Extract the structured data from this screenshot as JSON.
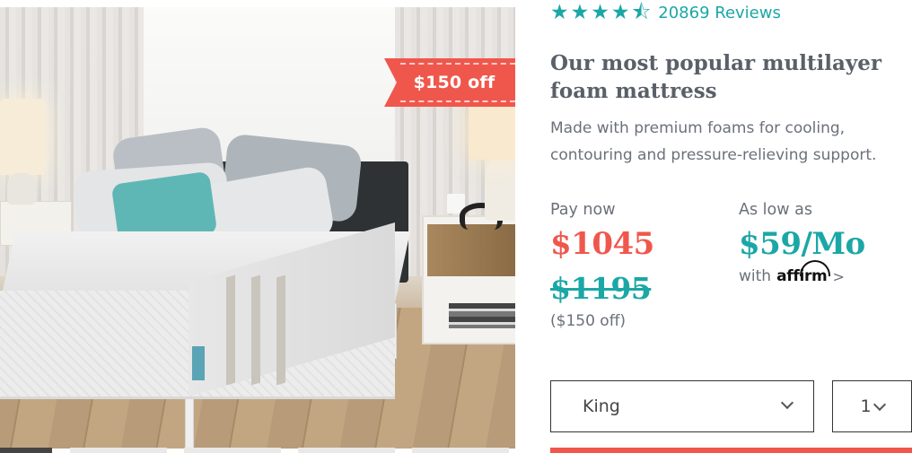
{
  "product_image": {
    "discount_ribbon": "$150 off"
  },
  "rating": {
    "stars": "★★★★⯪",
    "review_count_label": "20869 Reviews"
  },
  "product": {
    "title": "Our most popular multilayer foam mattress",
    "description": "Made with premium foams for cooling, contouring and pressure-relieving support."
  },
  "pricing": {
    "pay_now_label": "Pay now",
    "current_price": "$1045",
    "original_price": "$1195",
    "savings": "($150 off)",
    "financing_label": "As low as",
    "monthly_price": "$59/Mo",
    "with_label": "with",
    "provider": "affirm",
    "provider_arrow": ">"
  },
  "options": {
    "size_selected": "King",
    "quantity_selected": "1"
  },
  "colors": {
    "accent_teal": "#1ba7a6",
    "sale_red": "#f0574c",
    "text_gray": "#6b7079"
  }
}
